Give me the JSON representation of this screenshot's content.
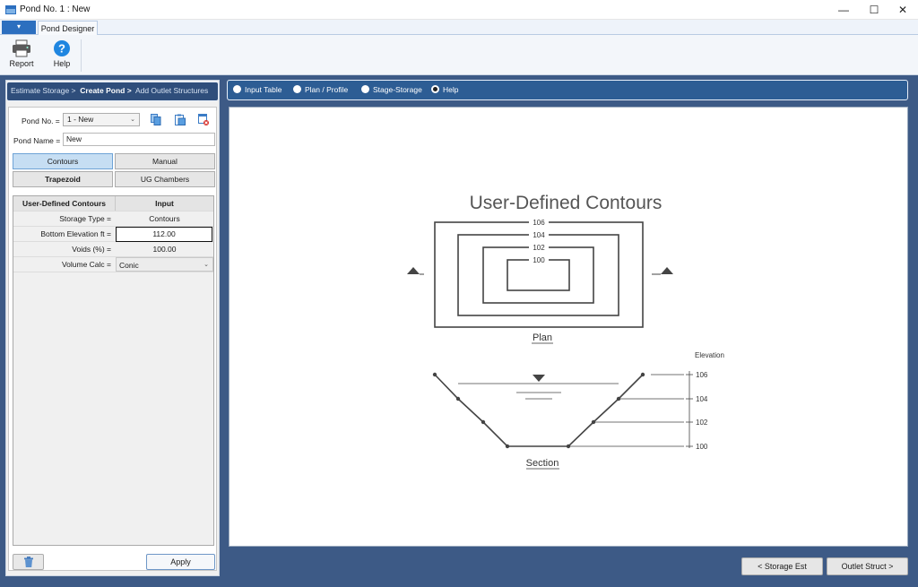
{
  "window": {
    "title": "Pond No. 1 : New",
    "minimize": "—",
    "maximize": "☐",
    "close": "✕"
  },
  "ribbon": {
    "file_tab": "▾",
    "tabs": [
      {
        "label": "Pond Designer"
      }
    ],
    "buttons": [
      {
        "label": "Report",
        "icon": "printer-icon"
      },
      {
        "label": "Help",
        "icon": "help-icon"
      }
    ]
  },
  "wizard": {
    "steps": [
      "Estimate Storage >",
      "Create Pond >",
      "Add Outlet Structures"
    ],
    "current": 1
  },
  "form": {
    "pond_no_label": "Pond No. =",
    "pond_no_value": "1 - New",
    "pond_name_label": "Pond Name =",
    "pond_name_value": "New",
    "type_buttons": [
      {
        "label": "Contours",
        "active": true
      },
      {
        "label": "Manual",
        "active": false
      },
      {
        "label": "Trapezoid",
        "active": false
      },
      {
        "label": "UG Chambers",
        "active": false
      }
    ]
  },
  "grid": {
    "headers": [
      "User-Defined Contours",
      "Input"
    ],
    "rows": [
      {
        "label": "Storage Type =",
        "value": "Contours"
      },
      {
        "label": "Bottom Elevation ft =",
        "value": "112.00"
      },
      {
        "label": "Voids (%) =",
        "value": "100.00"
      },
      {
        "label": "Volume Calc =",
        "value": "Conic"
      }
    ]
  },
  "apply_label": "Apply",
  "view_options": [
    {
      "label": "Input Table",
      "selected": false
    },
    {
      "label": "Plan / Profile",
      "selected": false
    },
    {
      "label": "Stage-Storage",
      "selected": false
    },
    {
      "label": "Help",
      "selected": true
    }
  ],
  "help_figure": {
    "title": "User-Defined Contours",
    "contour_labels": [
      "106",
      "104",
      "102",
      "100"
    ],
    "plan_label": "Plan",
    "section_label": "Section",
    "elevation_label": "Elevation"
  },
  "nav": {
    "back_label": "< Storage Est",
    "next_label": "Outlet Struct >"
  },
  "colors": {
    "accent": "#2d5d94",
    "background": "#3d5a86"
  }
}
